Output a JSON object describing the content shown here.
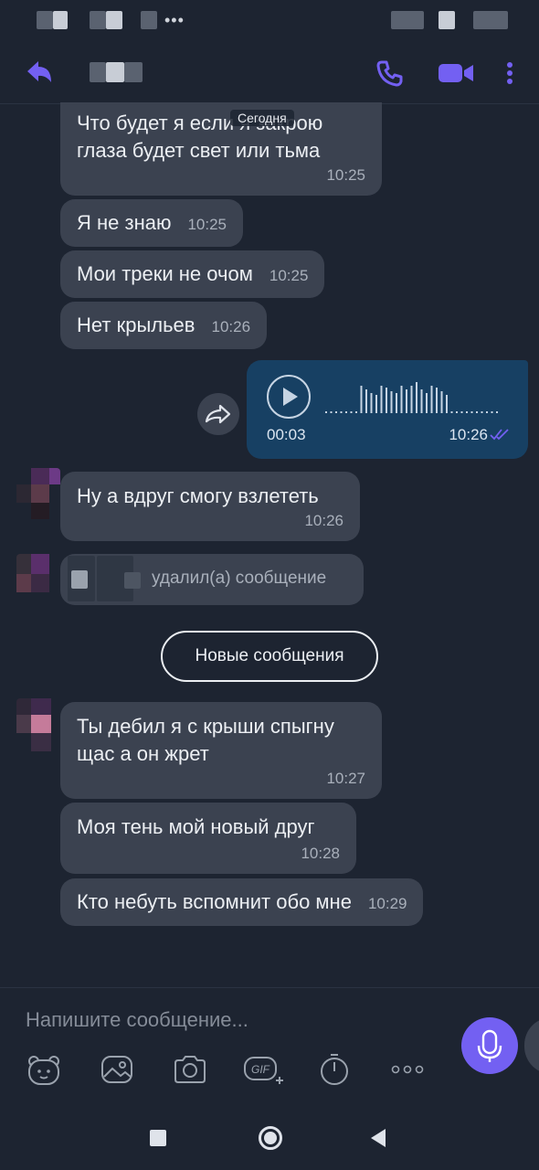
{
  "header": {
    "back_icon": "reply-arrow-icon",
    "call_icon": "phone-icon",
    "video_icon": "video-camera-icon",
    "more_icon": "kebab-menu-icon"
  },
  "date_separator": "Сегодня",
  "messages": [
    {
      "text": "Что будет я если я закрою глаза будет свет или тьма",
      "time": "10:25"
    },
    {
      "text": "Я не знаю",
      "time": "10:25"
    },
    {
      "text": "Мои треки не очом",
      "time": "10:25"
    },
    {
      "text": "Нет крыльев",
      "time": "10:26"
    }
  ],
  "voice_message": {
    "duration": "00:03",
    "time": "10:26",
    "status": "read"
  },
  "message_after_voice": {
    "text": "Ну а вдруг смогу взлететь",
    "time": "10:26"
  },
  "deleted_message": "удалил(а) сообщение",
  "new_messages_label": "Новые сообщения",
  "new_messages": [
    {
      "text": "Ты дебил я с крыши спыгну щас а он жрет",
      "time": "10:27"
    },
    {
      "text": "Моя тень мой новый друг",
      "time": "10:28"
    },
    {
      "text": "Кто небуть вспомнит обо мне",
      "time": "10:29"
    }
  ],
  "composer": {
    "placeholder": "Напишите сообщение...",
    "gif_label": "GIF",
    "tools": [
      "sticker-bear-icon",
      "gallery-icon",
      "camera-icon",
      "gif-icon",
      "timer-icon",
      "more-dots-icon"
    ]
  },
  "colors": {
    "background": "#1d2431",
    "incoming_bubble": "#3b4250",
    "outgoing_bubble": "#174063",
    "accent": "#7360f2"
  }
}
